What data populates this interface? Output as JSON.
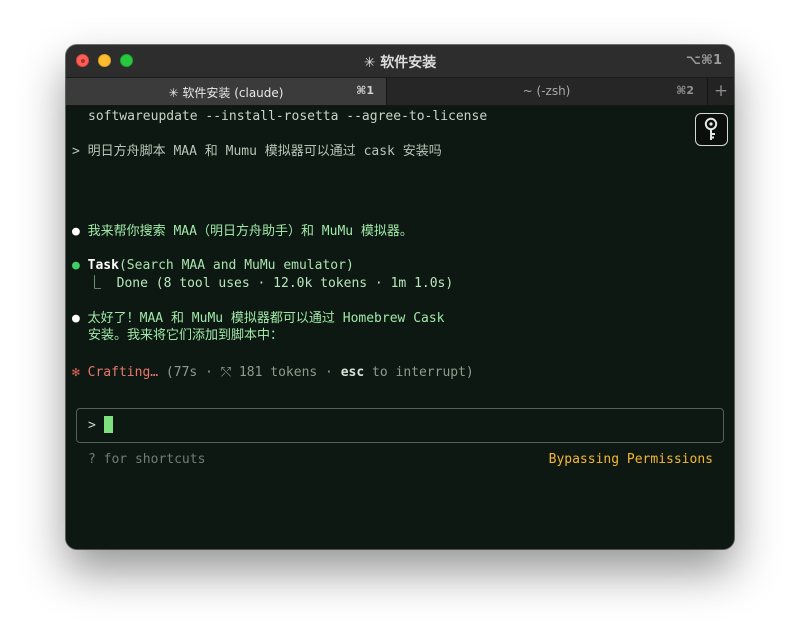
{
  "window": {
    "title": "✳ 软件安装",
    "shortcut": "⌥⌘1"
  },
  "tabs": [
    {
      "label": "✳ 软件安装 (claude)",
      "shortcut": "⌘1",
      "active": true
    },
    {
      "label": "~ (-zsh)",
      "shortcut": "⌘2",
      "active": false
    }
  ],
  "tab_add_label": "+",
  "terminal": {
    "previous_command": "softwareupdate --install-rosetta --agree-to-license",
    "user_message": "> 明日方舟脚本 MAA 和 Mumu 模拟器可以通过 cask 安装吗",
    "assistant_msg_1": {
      "bullet": "●",
      "text": "我来帮你搜索 MAA（明日方舟助手）和 MuMu 模拟器。"
    },
    "task": {
      "bullet": "●",
      "name": "Task",
      "args": "(Search MAA and MuMu emulator)",
      "result": "⎿  Done (8 tool uses · 12.0k tokens · 1m 1.0s)"
    },
    "assistant_msg_2": {
      "bullet": "●",
      "line1": "太好了！MAA 和 MuMu 模拟器都可以通过 Homebrew Cask",
      "line2": "安装。我来将它们添加到脚本中："
    },
    "status": {
      "star": "✻",
      "label": "Crafting…",
      "meta_before": " (77s · ⤲ 181 tokens · ",
      "key": "esc",
      "meta_after": " to interrupt)"
    },
    "input": {
      "prompt": ">",
      "value": ""
    },
    "shortcuts_hint": "? for shortcuts",
    "permission_mode": "Bypassing Permissions"
  },
  "colors": {
    "terminal_bg": "#0e1812",
    "accent_green": "#3ecf65",
    "message_green": "#9fe8a8",
    "crafting_red": "#e8776b",
    "permission_orange": "#f5b731",
    "cursor_green": "#7ee07f"
  },
  "icons": {
    "key_overlay": "key-icon"
  }
}
